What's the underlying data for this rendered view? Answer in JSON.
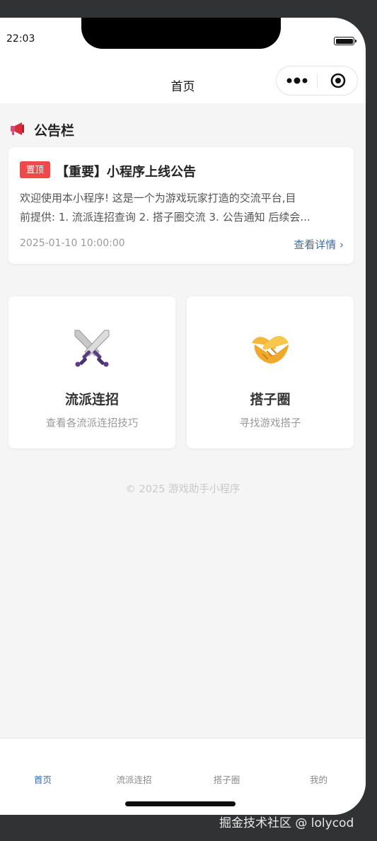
{
  "status_bar": {
    "time": "22:03"
  },
  "navbar": {
    "title": "首页"
  },
  "announcement": {
    "section_title": "公告栏",
    "pin_label": "置顶",
    "title": "【重要】小程序上线公告",
    "body_lines": [
      "欢迎使用本小程序! 这是一个为游戏玩家打造的交流平台,目",
      "前提供: 1. 流派连招查询 2. 搭子圈交流 3. 公告通知 后续会..."
    ],
    "date": "2025-01-10 10:00:00",
    "more_label": "查看详情 ›"
  },
  "features": [
    {
      "title": "流派连招",
      "desc": "查看各流派连招技巧",
      "icon": "crossed-swords-icon"
    },
    {
      "title": "搭子圈",
      "desc": "寻找游戏搭子",
      "icon": "handshake-icon"
    }
  ],
  "footer": {
    "copyright": "© 2025 游戏助手小程序"
  },
  "tabbar": {
    "items": [
      {
        "label": "首页",
        "active": true
      },
      {
        "label": "流派连招",
        "active": false
      },
      {
        "label": "搭子圈",
        "active": false
      },
      {
        "label": "我的",
        "active": false
      }
    ]
  },
  "watermark": "掘金技术社区 @ lolycod",
  "colors": {
    "accent": "#3a6ea8",
    "pin_badge": "#ee4a4a",
    "background": "#f5f5f5"
  }
}
